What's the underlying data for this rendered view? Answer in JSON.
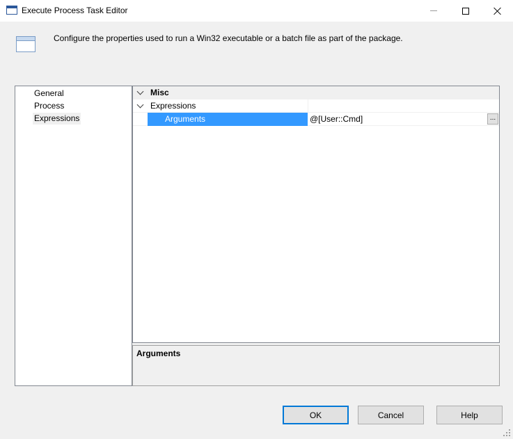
{
  "window": {
    "title": "Execute Process Task Editor",
    "icon": "window-icon"
  },
  "header": {
    "description": "Configure the properties used to run a Win32 executable or a batch file as part of the package."
  },
  "nav": {
    "items": [
      {
        "label": "General",
        "selected": false
      },
      {
        "label": "Process",
        "selected": false
      },
      {
        "label": "Expressions",
        "selected": true
      }
    ]
  },
  "grid": {
    "category": "Misc",
    "subcategory": "Expressions",
    "property": {
      "name": "Arguments",
      "value": "@[User::Cmd]",
      "ellipsis_label": "..."
    }
  },
  "description": {
    "title": "Arguments"
  },
  "buttons": {
    "ok": "OK",
    "cancel": "Cancel",
    "help": "Help"
  },
  "colors": {
    "selection": "#3399ff",
    "default_button_border": "#0078d7",
    "dialog_background": "#f0f0f0"
  }
}
